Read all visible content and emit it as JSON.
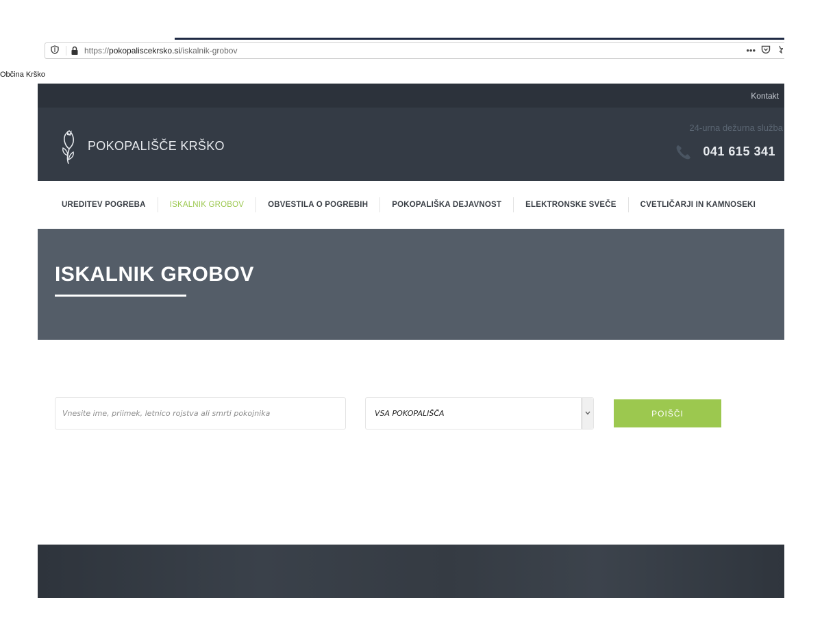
{
  "browser": {
    "url_prefix": "https://",
    "url_domain": "pokopaliscekrsko.si",
    "url_path": "/iskalnik-grobov",
    "bookmark": "Občina Krško",
    "menu_glyph": "•••"
  },
  "topbar": {
    "contact": "Kontakt"
  },
  "header": {
    "brand": "POKOPALIŠČE KRŠKO",
    "duty_label": "24-urna dežurna služba",
    "phone": "041 615 341"
  },
  "nav": {
    "items": [
      "UREDITEV POGREBA",
      "ISKALNIK GROBOV",
      "OBVESTILA O POGREBIH",
      "POKOPALIŠKA DEJAVNOST",
      "ELEKTRONSKE SVEČE",
      "CVETLIČARJI IN KAMNOSEKI"
    ],
    "active_index": 1
  },
  "hero": {
    "title": "ISKALNIK GROBOV"
  },
  "search": {
    "placeholder": "Vnesite ime, priimek, letnico rojstva ali smrti pokojnika",
    "cemetery_selected": "VSA POKOPALIŠČA",
    "button": "POIŠČI"
  },
  "colors": {
    "accent": "#9cc84f",
    "dark": "#343b45",
    "hero": "#545d68"
  }
}
